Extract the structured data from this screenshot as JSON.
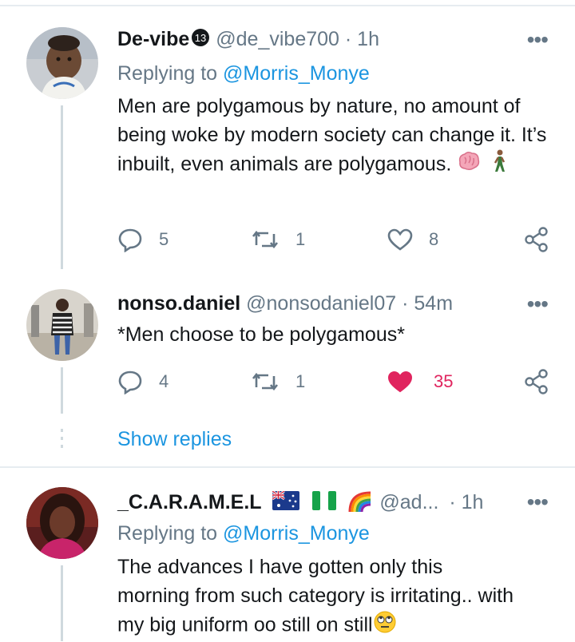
{
  "tweets": [
    {
      "name": "De-vibe",
      "badge": "13",
      "handle": "@de_vibe700",
      "time": "1h",
      "replying_prefix": "Replying to",
      "replying_to": "@Morris_Monye",
      "text": "Men are polygamous by nature, no amount of being woke by modern society can change it. It’s inbuilt, even animals are polygamous.",
      "emojis": [
        "brain-emoji",
        "walking-man-emoji"
      ],
      "replies": "5",
      "retweets": "1",
      "likes": "8",
      "liked": false
    },
    {
      "name": "nonso.daniel",
      "handle": "@nonsodaniel07",
      "time": "54m",
      "text": "*Men choose to be polygamous*",
      "replies": "4",
      "retweets": "1",
      "likes": "35",
      "liked": true,
      "like_color": "#e0245e"
    },
    {
      "name": "_C.A.R.A.M.E.L",
      "flags": [
        "australia-flag",
        "nigeria-flag",
        "rainbow-emoji"
      ],
      "handle": "@ad...",
      "time": "1h",
      "replying_prefix": "Replying to",
      "replying_to": "@Morris_Monye",
      "text": "The advances I have gotten only this morning from such category is irritating.. with my big uniform oo still on still",
      "emojis": [
        "eye-roll-emoji"
      ]
    }
  ],
  "show_replies": "Show replies",
  "separator": "·",
  "colors": {
    "link": "#1b95e0",
    "muted": "#657786",
    "like": "#e0245e",
    "line": "#cfd9de"
  }
}
